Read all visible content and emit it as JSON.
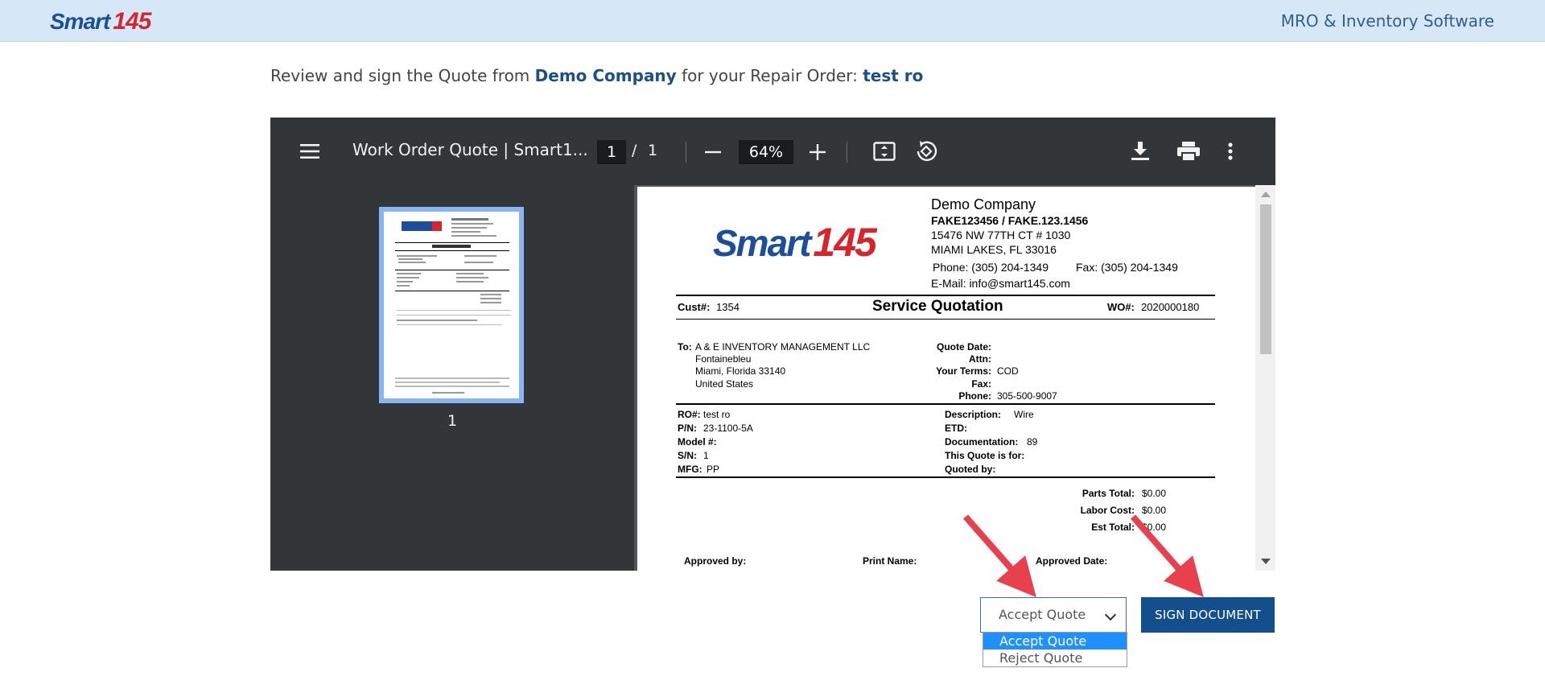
{
  "header": {
    "logo_word": "Smart",
    "logo_num": "145",
    "tagline": "MRO & Inventory Software"
  },
  "headline": {
    "prefix": "Review and sign the Quote from",
    "company": "Demo Company",
    "middle": "for your Repair Order:",
    "ro": "test ro"
  },
  "viewer": {
    "title": "Work Order Quote | Smart1...",
    "page_current": "1",
    "page_sep": "/",
    "page_total": "1",
    "zoom": "64%",
    "thumb_page_label": "1"
  },
  "document": {
    "company": "Demo Company",
    "company_ids": "FAKE123456 / FAKE.123.1456",
    "address1": "15476 NW 77TH CT # 1030",
    "address2": "MIAMI LAKES, FL 33016",
    "phone": "Phone: (305) 204-1349",
    "fax": "Fax: (305) 204-1349",
    "email": "E-Mail: info@smart145.com",
    "cust_label": "Cust#:",
    "cust_value": "1354",
    "title": "Service Quotation",
    "wo_label": "WO#:",
    "wo_value": "2020000180",
    "to_label": "To:",
    "to_name": "A & E INVENTORY MANAGEMENT LLC",
    "to_line2": "Fontainebleu",
    "to_line3": "Miami, Florida 33140",
    "to_line4": "United States",
    "quote_date_label": "Quote Date:",
    "attn_label": "Attn:",
    "terms_label": "Your Terms:",
    "terms_value": "COD",
    "fax_label": "Fax:",
    "phone_label": "Phone:",
    "phone_value": "305-500-9007",
    "ro_label": "RO#:",
    "ro_value": "test ro",
    "pn_label": "P/N:",
    "pn_value": "23-1100-5A",
    "model_label": "Model #:",
    "sn_label": "S/N:",
    "sn_value": "1",
    "mfg_label": "MFG:",
    "mfg_value": "PP",
    "desc_label": "Description:",
    "desc_value": "Wire",
    "etd_label": "ETD:",
    "doc_label": "Documentation:",
    "doc_value": "89",
    "quote_for_label": "This Quote is for:",
    "quoted_by_label": "Quoted by:",
    "parts_label": "Parts Total:",
    "parts_value": "$0.00",
    "labor_label": "Labor Cost:",
    "labor_value": "$0.00",
    "est_label": "Est Total:",
    "est_value": "$0.00",
    "approved_by_label": "Approved by:",
    "print_name_label": "Print Name:",
    "approved_date_label": "Approved Date:"
  },
  "actions": {
    "select_value": "Accept Quote",
    "options": [
      "Accept Quote",
      "Reject Quote"
    ],
    "sign_label": "SIGN DOCUMENT"
  }
}
